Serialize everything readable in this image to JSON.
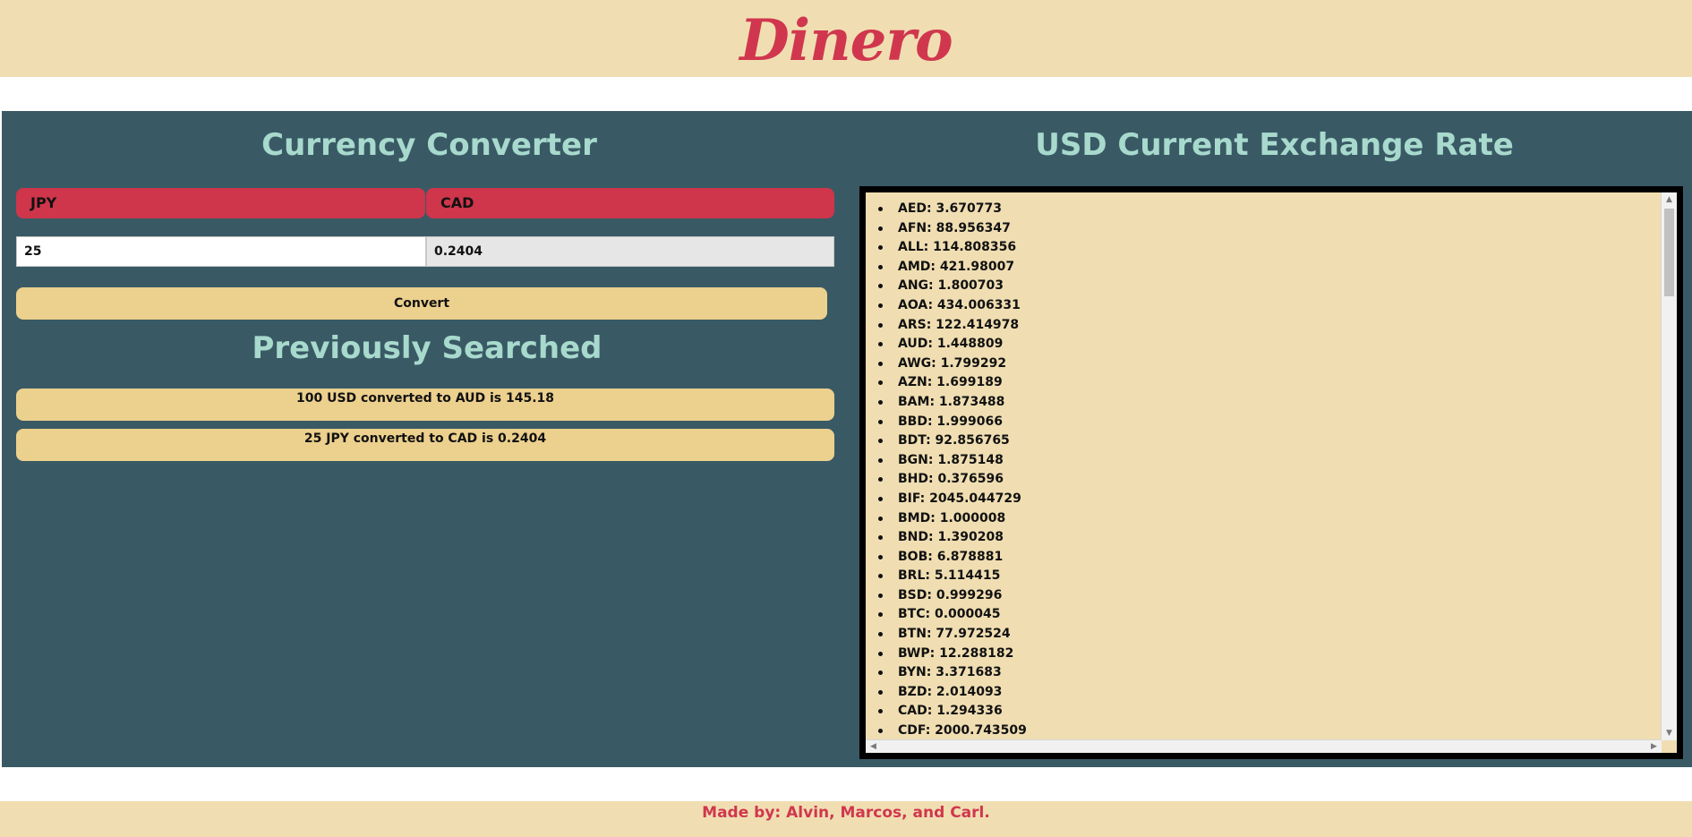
{
  "header": {
    "brand": "Dinero"
  },
  "converter": {
    "title": "Currency Converter",
    "from_currency": "JPY",
    "to_currency": "CAD",
    "amount": "25",
    "result": "0.2404",
    "convert_label": "Convert"
  },
  "history": {
    "title": "Previously Searched",
    "items": [
      "100 USD converted to AUD is 145.18",
      "25 JPY converted to CAD is 0.2404"
    ]
  },
  "rates": {
    "title": "USD Current Exchange Rate",
    "items": [
      "AED: 3.670773",
      "AFN: 88.956347",
      "ALL: 114.808356",
      "AMD: 421.98007",
      "ANG: 1.800703",
      "AOA: 434.006331",
      "ARS: 122.414978",
      "AUD: 1.448809",
      "AWG: 1.799292",
      "AZN: 1.699189",
      "BAM: 1.873488",
      "BBD: 1.999066",
      "BDT: 92.856765",
      "BGN: 1.875148",
      "BHD: 0.376596",
      "BIF: 2045.044729",
      "BMD: 1.000008",
      "BND: 1.390208",
      "BOB: 6.878881",
      "BRL: 5.114415",
      "BSD: 0.999296",
      "BTC: 0.000045",
      "BTN: 77.972524",
      "BWP: 12.288182",
      "BYN: 3.371683",
      "BZD: 2.014093",
      "CAD: 1.294336",
      "CDF: 2000.743509"
    ]
  },
  "footer": {
    "credit": "Made by: Alvin, Marcos, and Carl."
  },
  "colors": {
    "header_bg": "#f0deb2",
    "panel_bg": "#395a65",
    "accent": "#d0374e",
    "title_text": "#a8d9cd",
    "button_bg": "#ecd08d"
  }
}
